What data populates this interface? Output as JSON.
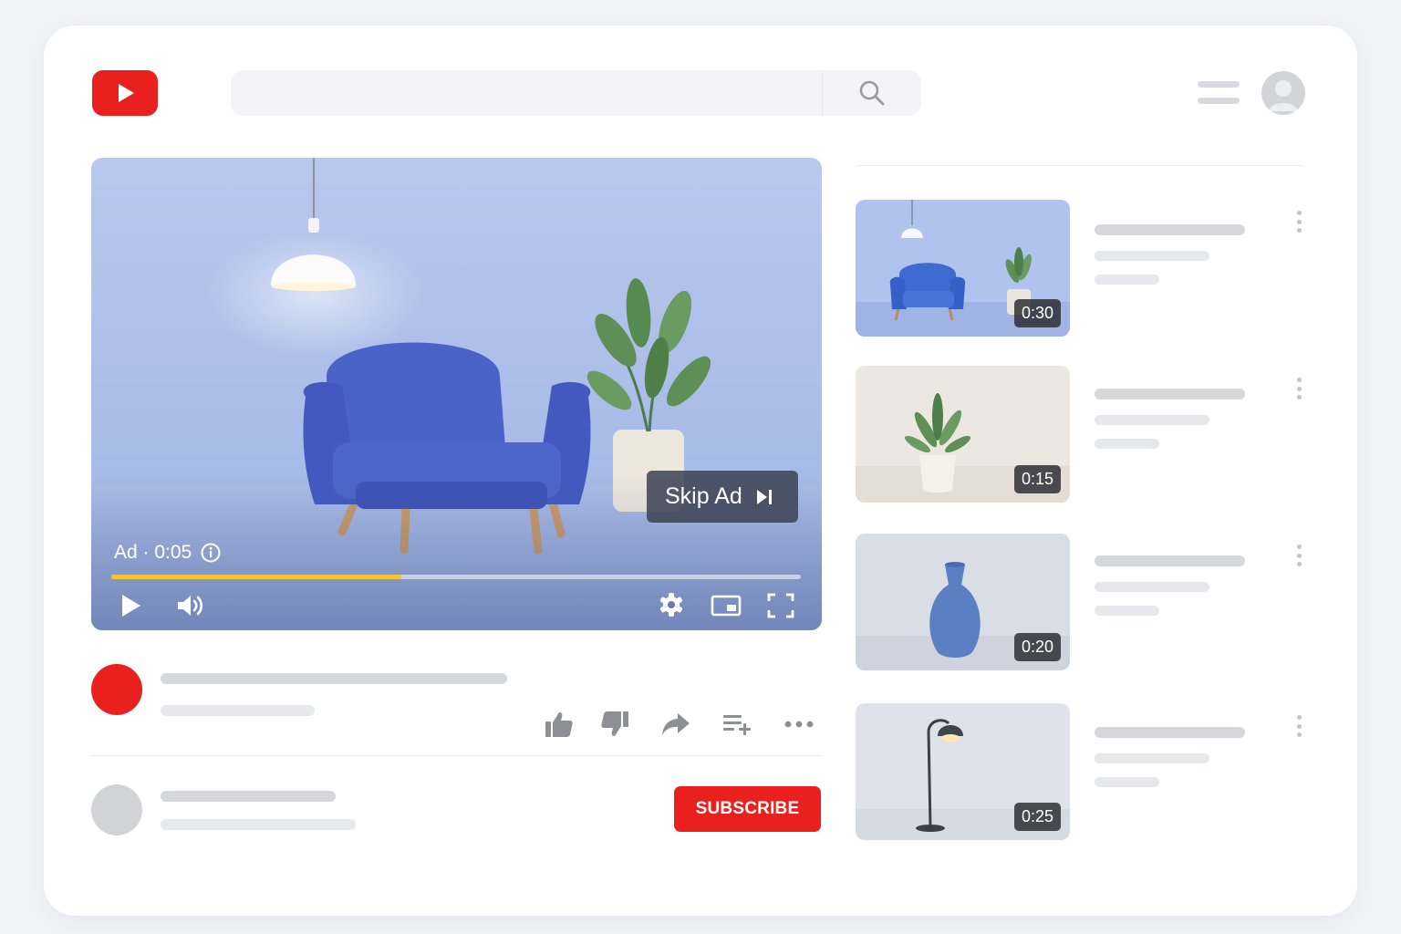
{
  "header": {
    "logo": "youtube-logo",
    "search": {
      "value": "",
      "placeholder": "",
      "icon": "search-icon"
    },
    "menu_icon": "hamburger-icon",
    "avatar_icon": "user-avatar-icon"
  },
  "player": {
    "skip_label": "Skip Ad",
    "ad_label": "Ad · 0:05",
    "progress": 0.42,
    "icons": [
      "play-icon",
      "volume-icon",
      "settings-icon",
      "miniplayer-icon",
      "fullscreen-icon",
      "info-icon",
      "skip-next-icon"
    ]
  },
  "video_actions": [
    "like-icon",
    "dislike-icon",
    "share-icon",
    "add-to-playlist-icon",
    "more-icon"
  ],
  "subscribe_label": "SUBSCRIBE",
  "recommendations": [
    {
      "duration": "0:30",
      "scene": "armchair-room"
    },
    {
      "duration": "0:15",
      "scene": "potted-plant"
    },
    {
      "duration": "0:20",
      "scene": "blue-vase"
    },
    {
      "duration": "0:25",
      "scene": "floor-lamp"
    }
  ],
  "colors": {
    "brand_red": "#e9201d",
    "progress_yellow": "#f4c531",
    "placeholder_gray": "#d6d7db"
  }
}
